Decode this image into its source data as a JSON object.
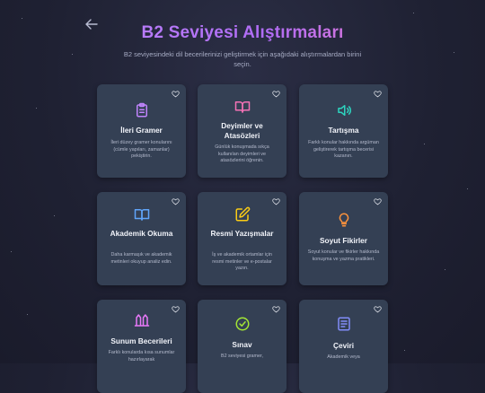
{
  "page": {
    "title": "B2 Seviyesi Alıştırmaları",
    "subtitle": "B2 seviyesindeki dil becerilerinizi geliştirmek için aşağıdaki alıştırmalardan birini seçin."
  },
  "colors": {
    "background": "#1f2133",
    "card": "#344054",
    "title_gradient_start": "#c08cff",
    "title_gradient_end": "#ff7fb8"
  },
  "cards": [
    {
      "title": "İleri Gramer",
      "desc": "İleri düzey gramer konularını (cümle yapıları, zamanlar) pekiştirin.",
      "icon": "clipboard-icon",
      "color": "#c084fc"
    },
    {
      "title": "Deyimler ve Atasözleri",
      "desc": "Günlük konuşmada sıkça kullanılan deyimleri ve atasözlerini öğrenin.",
      "icon": "book-open-icon",
      "color": "#f472b6"
    },
    {
      "title": "Tartışma",
      "desc": "Farklı konular hakkında argüman geliştirerek tartışma becerisi kazanın.",
      "icon": "speaker-icon",
      "color": "#2dd4bf"
    },
    {
      "title": "Akademik Okuma",
      "desc": "Daha karmaşık ve akademik metinleri okuyup analiz edin.",
      "icon": "book-icon",
      "color": "#60a5fa"
    },
    {
      "title": "Resmi Yazışmalar",
      "desc": "İş ve akademik ortamlar için resmi metinler ve e-postalar yazın.",
      "icon": "edit-icon",
      "color": "#facc15"
    },
    {
      "title": "Soyut Fikirler",
      "desc": "Soyut konular ve fikirler hakkında konuşma ve yazma pratikleri.",
      "icon": "lightbulb-icon",
      "color": "#fb923c"
    },
    {
      "title": "Sunum Becerileri",
      "desc": "Farklı konularda kısa sunumlar hazırlayarak",
      "icon": "presentation-icon",
      "color": "#e879f9"
    },
    {
      "title": "Sınav",
      "desc": "B2 seviyesi gramer,",
      "icon": "check-circle-icon",
      "color": "#a3e635"
    },
    {
      "title": "Çeviri",
      "desc": "Akademik veya",
      "icon": "translate-icon",
      "color": "#818cf8"
    }
  ]
}
